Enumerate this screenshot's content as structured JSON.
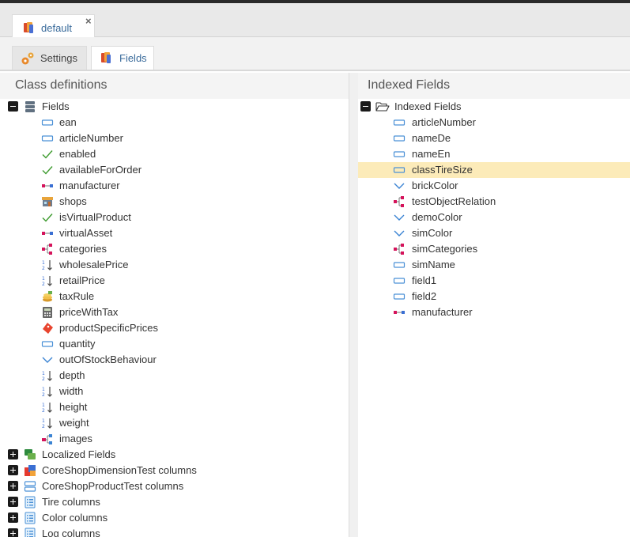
{
  "document_tab": {
    "label": "default",
    "icon": "class-icon",
    "close_label": "×"
  },
  "sub_tabs": [
    {
      "label": "Settings",
      "icon": "gears-icon"
    },
    {
      "label": "Fields",
      "icon": "class-icon"
    }
  ],
  "left_panel": {
    "title": "Class definitions",
    "root": {
      "label": "Fields",
      "icon": "database-icon",
      "expanded": true
    },
    "fields": [
      {
        "label": "ean",
        "icon": "input-icon"
      },
      {
        "label": "articleNumber",
        "icon": "input-icon"
      },
      {
        "label": "enabled",
        "icon": "checkbox-icon"
      },
      {
        "label": "availableForOrder",
        "icon": "checkbox-icon"
      },
      {
        "label": "manufacturer",
        "icon": "relation-icon"
      },
      {
        "label": "shops",
        "icon": "shop-icon"
      },
      {
        "label": "isVirtualProduct",
        "icon": "checkbox-icon"
      },
      {
        "label": "virtualAsset",
        "icon": "relation-icon"
      },
      {
        "label": "categories",
        "icon": "multirelation-icon"
      },
      {
        "label": "wholesalePrice",
        "icon": "numeric-icon"
      },
      {
        "label": "retailPrice",
        "icon": "numeric-icon"
      },
      {
        "label": "taxRule",
        "icon": "tax-icon"
      },
      {
        "label": "priceWithTax",
        "icon": "calculator-icon"
      },
      {
        "label": "productSpecificPrices",
        "icon": "price-rule-icon"
      },
      {
        "label": "quantity",
        "icon": "input-icon"
      },
      {
        "label": "outOfStockBehaviour",
        "icon": "select-icon"
      },
      {
        "label": "depth",
        "icon": "numeric-icon"
      },
      {
        "label": "width",
        "icon": "numeric-icon"
      },
      {
        "label": "height",
        "icon": "numeric-icon"
      },
      {
        "label": "weight",
        "icon": "numeric-icon"
      },
      {
        "label": "images",
        "icon": "gallery-icon"
      }
    ],
    "groups": [
      {
        "label": "Localized Fields",
        "icon": "localized-icon"
      },
      {
        "label": "CoreShopDimensionTest columns",
        "icon": "objectbrick-icon"
      },
      {
        "label": "CoreShopProductTest columns",
        "icon": "fieldcollection-icon"
      },
      {
        "label": "Tire columns",
        "icon": "columns-icon"
      },
      {
        "label": "Color columns",
        "icon": "columns-icon"
      },
      {
        "label": "Log columns",
        "icon": "columns-icon"
      }
    ]
  },
  "right_panel": {
    "title": "Indexed Fields",
    "root": {
      "label": "Indexed Fields",
      "icon": "folder-open-icon",
      "expanded": true
    },
    "fields": [
      {
        "label": "articleNumber",
        "icon": "input-icon",
        "selected": false
      },
      {
        "label": "nameDe",
        "icon": "input-icon",
        "selected": false
      },
      {
        "label": "nameEn",
        "icon": "input-icon",
        "selected": false
      },
      {
        "label": "classTireSize",
        "icon": "input-icon",
        "selected": true
      },
      {
        "label": "brickColor",
        "icon": "select-icon",
        "selected": false
      },
      {
        "label": "testObjectRelation",
        "icon": "multirelation-icon",
        "selected": false
      },
      {
        "label": "demoColor",
        "icon": "select-icon",
        "selected": false
      },
      {
        "label": "simColor",
        "icon": "select-icon",
        "selected": false
      },
      {
        "label": "simCategories",
        "icon": "multirelation-icon",
        "selected": false
      },
      {
        "label": "simName",
        "icon": "input-icon",
        "selected": false
      },
      {
        "label": "field1",
        "icon": "input-icon",
        "selected": false
      },
      {
        "label": "field2",
        "icon": "input-icon",
        "selected": false
      },
      {
        "label": "manufacturer",
        "icon": "relation-icon",
        "selected": false
      }
    ]
  },
  "colors": {
    "accent_blue": "#3a6b9b",
    "selected_row": "#fcebb9",
    "relation_red": "#d5135b",
    "check_green": "#3c9a2d",
    "input_blue": "#4a90d6"
  }
}
